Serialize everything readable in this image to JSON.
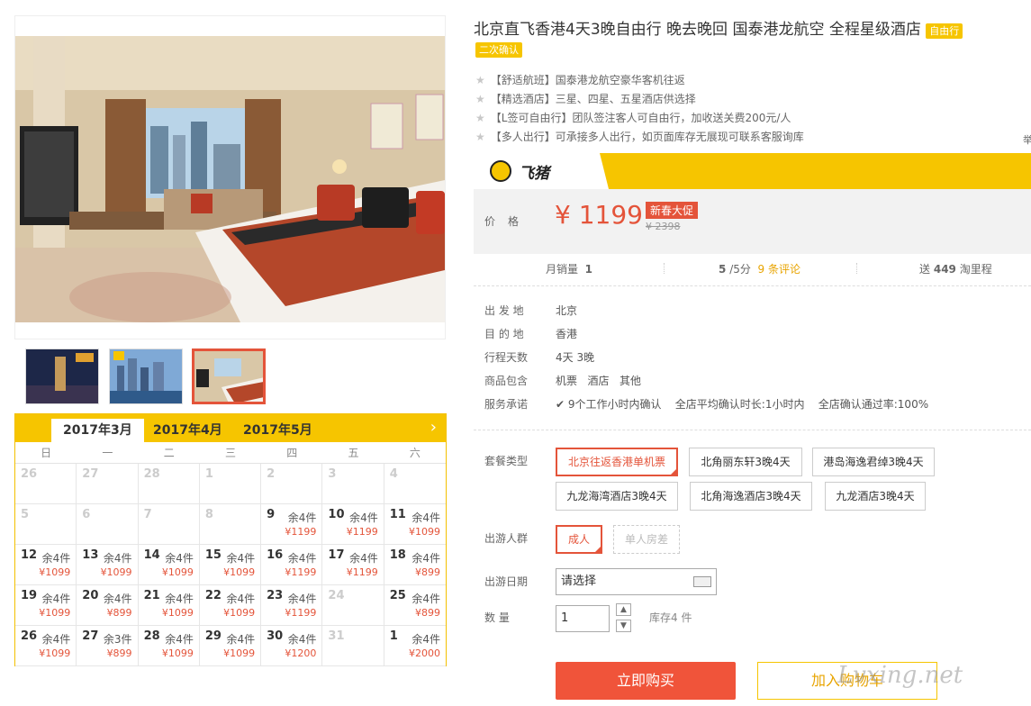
{
  "product": {
    "title": "北京直飞香港4天3晚自由行 晚去晚回 国泰港龙航空 全程星级酒店",
    "tag_free": "自由行",
    "tag_confirm": "二次确认"
  },
  "features": [
    "【舒适航班】国泰港龙航空豪华客机往返",
    "【精选酒店】三星、四星、五星酒店供选择",
    "【L签可自由行】团队签注客人可自由行，加收送关费200元/人",
    "【多人出行】可承接多人出行，如页面库存无展现可联系客服询库"
  ],
  "side_cut_label": "举",
  "brand": {
    "name": "飞猪"
  },
  "price": {
    "label": "价格",
    "current": "¥ 1199",
    "promo_tag": "新春大促",
    "original": "¥ 2398"
  },
  "stats": {
    "monthly_sales_label": "月销量",
    "monthly_sales": "1",
    "score": "5",
    "score_suffix": "/5分",
    "reviews": "9 条评论",
    "points_prefix": "送",
    "points": "449",
    "points_suffix": "淘里程"
  },
  "info": {
    "depart_label": "出 发 地",
    "depart": "北京",
    "dest_label": "目 的 地",
    "dest": "香港",
    "days_label": "行程天数",
    "days": "4天 3晚",
    "includes_label": "商品包含",
    "includes": [
      "机票",
      "酒店",
      "其他"
    ],
    "service_label": "服务承诺",
    "service_items": [
      "9个工作小时内确认",
      "全店平均确认时长:1小时内",
      "全店确认通过率:100%"
    ]
  },
  "package": {
    "label": "套餐类型",
    "options": [
      "北京往返香港单机票",
      "北角丽东轩3晚4天",
      "港岛海逸君绰3晚4天",
      "九龙海湾酒店3晚4天",
      "北角海逸酒店3晚4天",
      "九龙酒店3晚4天"
    ],
    "selected": 0
  },
  "travelers": {
    "label": "出游人群",
    "options": [
      "成人",
      "单人房差"
    ]
  },
  "date": {
    "label": "出游日期",
    "placeholder": "请选择"
  },
  "quantity": {
    "label": "数 量",
    "value": "1",
    "stock": "库存4 件"
  },
  "buttons": {
    "buy": "立即购买",
    "cart": "加入购物车"
  },
  "watermark": "Lvxing.net",
  "calendar": {
    "tabs": [
      "2017年3月",
      "2017年4月",
      "2017年5月"
    ],
    "active_tab": 0,
    "weekdays": [
      "日",
      "一",
      "二",
      "三",
      "四",
      "五",
      "六"
    ],
    "days": [
      {
        "d": "26",
        "dis": true
      },
      {
        "d": "27",
        "dis": true
      },
      {
        "d": "28",
        "dis": true
      },
      {
        "d": "1",
        "dis": true
      },
      {
        "d": "2",
        "dis": true
      },
      {
        "d": "3",
        "dis": true
      },
      {
        "d": "4",
        "dis": true
      },
      {
        "d": "5",
        "dis": true
      },
      {
        "d": "6",
        "dis": true
      },
      {
        "d": "7",
        "dis": true
      },
      {
        "d": "8",
        "dis": true
      },
      {
        "d": "9",
        "s": "余4件",
        "p": "¥1199"
      },
      {
        "d": "10",
        "s": "余4件",
        "p": "¥1199"
      },
      {
        "d": "11",
        "s": "余4件",
        "p": "¥1099"
      },
      {
        "d": "12",
        "s": "余4件",
        "p": "¥1099"
      },
      {
        "d": "13",
        "s": "余4件",
        "p": "¥1099"
      },
      {
        "d": "14",
        "s": "余4件",
        "p": "¥1099"
      },
      {
        "d": "15",
        "s": "余4件",
        "p": "¥1099"
      },
      {
        "d": "16",
        "s": "余4件",
        "p": "¥1199"
      },
      {
        "d": "17",
        "s": "余4件",
        "p": "¥1199"
      },
      {
        "d": "18",
        "s": "余4件",
        "p": "¥899"
      },
      {
        "d": "19",
        "s": "余4件",
        "p": "¥1099"
      },
      {
        "d": "20",
        "s": "余4件",
        "p": "¥899"
      },
      {
        "d": "21",
        "s": "余4件",
        "p": "¥1099"
      },
      {
        "d": "22",
        "s": "余4件",
        "p": "¥1099"
      },
      {
        "d": "23",
        "s": "余4件",
        "p": "¥1199"
      },
      {
        "d": "24",
        "dis": true
      },
      {
        "d": "25",
        "s": "余4件",
        "p": "¥899"
      },
      {
        "d": "26",
        "s": "余4件",
        "p": "¥1099"
      },
      {
        "d": "27",
        "s": "余3件",
        "p": "¥899"
      },
      {
        "d": "28",
        "s": "余4件",
        "p": "¥1099"
      },
      {
        "d": "29",
        "s": "余4件",
        "p": "¥1099"
      },
      {
        "d": "30",
        "s": "余4件",
        "p": "¥1200"
      },
      {
        "d": "31",
        "dis": true
      },
      {
        "d": "1",
        "s": "余4件",
        "p": "¥2000"
      }
    ]
  },
  "colors": {
    "accent": "#e4543a",
    "brand_yellow": "#f6c500"
  }
}
